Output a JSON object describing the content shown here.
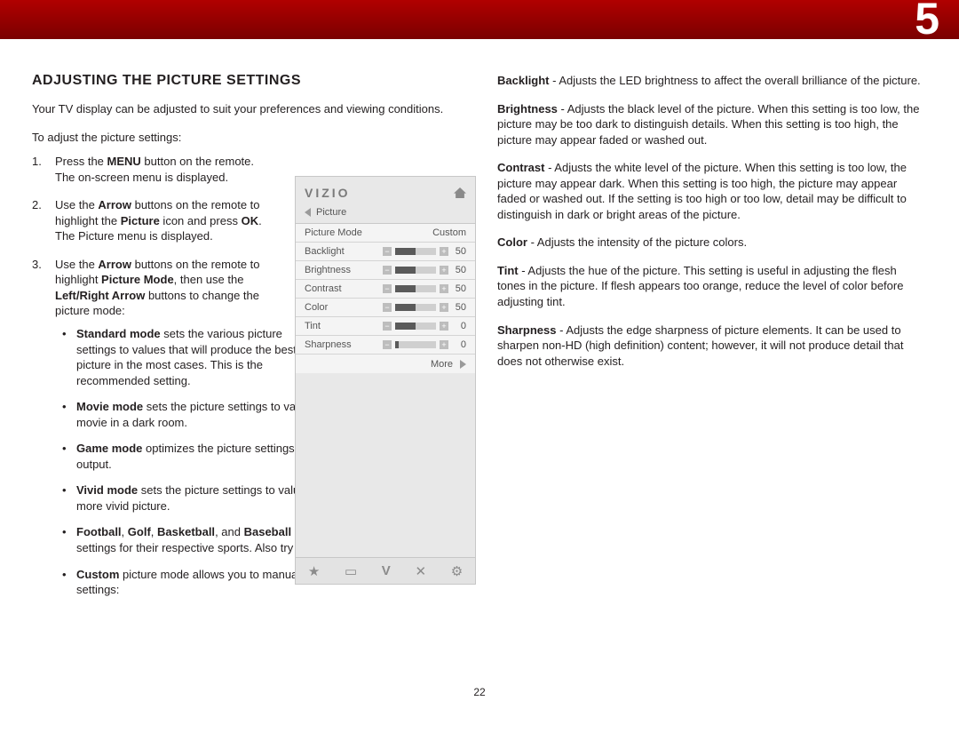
{
  "chapter_number": "5",
  "page_number": "22",
  "left": {
    "heading": "Adjusting the Picture Settings",
    "intro": "Your TV display can be adjusted to suit your preferences and viewing conditions.",
    "lead": "To adjust the picture settings:",
    "step1_a": "Press the ",
    "step1_b": "MENU",
    "step1_c": " button on the remote. The on-screen menu is displayed.",
    "step2_a": "Use the ",
    "step2_b": "Arrow",
    "step2_c": " buttons on the remote to highlight the ",
    "step2_d": "Picture",
    "step2_e": " icon and press ",
    "step2_f": "OK",
    "step2_g": ". The Picture menu is displayed.",
    "step3_a": "Use the ",
    "step3_b": "Arrow",
    "step3_c": " buttons on the remote to highlight ",
    "step3_d": "Picture Mode",
    "step3_e": ", then use the ",
    "step3_f": "Left/Right Arrow",
    "step3_g": " buttons to change the picture mode:",
    "b1_a": "Standard mode",
    "b1_b": " sets the various picture settings to values that will produce the best picture in the most cases. This is the recommended setting.",
    "b2_a": "Movie mode",
    "b2_b": " sets the picture settings to values perfect for watching a movie in a dark room.",
    "b3_a": "Game mode",
    "b3_b": " optimizes the picture settings for displaying game console output.",
    "b4_a": "Vivid mode",
    "b4_b": " sets the picture settings to values that produce a brighter, more vivid picture.",
    "b5_a": "Football",
    "b5_b": ", ",
    "b5_c": "Golf",
    "b5_d": ", ",
    "b5_e": "Basketball",
    "b5_f": ", and ",
    "b5_g": "Baseball",
    "b5_h": " modes optimize the picture settings for their respective sports. Also try these modes for other sports.",
    "b6_a": "Custom",
    "b6_b": " picture mode allows you to manually change each of the picture settings:"
  },
  "right": {
    "p1_a": "Backlight",
    "p1_b": " - Adjusts the LED brightness to affect the overall brilliance of the picture.",
    "p2_a": "Brightness",
    "p2_b": " - Adjusts the black level of the picture. When this setting is too low, the picture may be too dark to distinguish details. When this setting is too high, the picture may appear faded or washed out.",
    "p3_a": "Contrast",
    "p3_b": " - Adjusts the white level of the picture. When this setting is too low, the picture may appear dark. When this setting is too high, the picture may appear faded or washed out. If the setting is too high or too low, detail may be difficult to distinguish in dark or bright areas of the picture.",
    "p4_a": "Color",
    "p4_b": " - Adjusts the intensity of the picture colors.",
    "p5_a": "Tint",
    "p5_b": " - Adjusts the hue of the picture. This setting is useful in adjusting the flesh tones in the picture. If flesh appears too orange, reduce the level of color before adjusting tint.",
    "p6_a": "Sharpness",
    "p6_b": " - Adjusts the edge sharpness of picture elements. It can be used to sharpen non-HD (high definition) content; however, it will not produce detail that does not otherwise exist."
  },
  "osd": {
    "brand": "VIZIO",
    "crumb": "Picture",
    "rows": [
      {
        "label": "Picture Mode",
        "value": "Custom",
        "type": "text"
      },
      {
        "label": "Backlight",
        "value": "50",
        "type": "slider",
        "fill": 50
      },
      {
        "label": "Brightness",
        "value": "50",
        "type": "slider",
        "fill": 50
      },
      {
        "label": "Contrast",
        "value": "50",
        "type": "slider",
        "fill": 50
      },
      {
        "label": "Color",
        "value": "50",
        "type": "slider",
        "fill": 50
      },
      {
        "label": "Tint",
        "value": "0",
        "type": "slider",
        "fill": 50
      },
      {
        "label": "Sharpness",
        "value": "0",
        "type": "slider",
        "fill": 8
      }
    ],
    "more": "More",
    "foot_icons": [
      "star-icon",
      "wide-icon",
      "v-icon",
      "close-icon",
      "gear-icon"
    ]
  }
}
